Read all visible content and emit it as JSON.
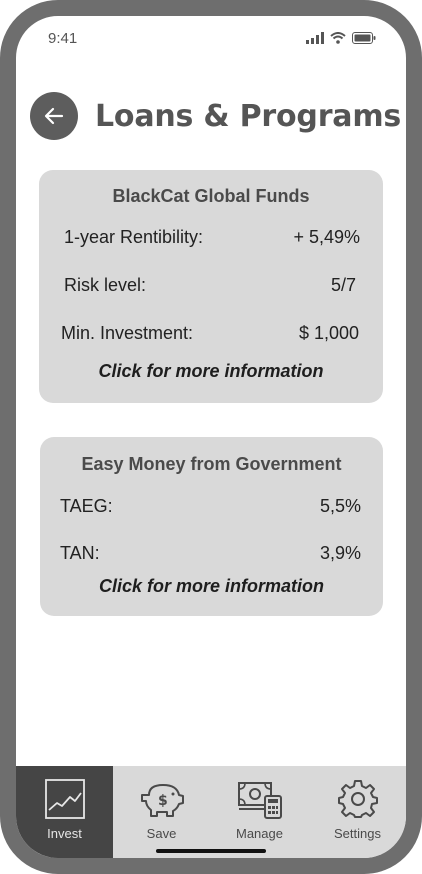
{
  "status": {
    "time": "9:41"
  },
  "header": {
    "title": "Loans & Programs"
  },
  "cards": [
    {
      "title": "BlackCat Global Funds",
      "rows": [
        {
          "label": "1-year Rentibility:",
          "value": "+ 5,49%"
        },
        {
          "label": "Risk level:",
          "value": "5/7"
        },
        {
          "label": "Min. Investment:",
          "value": "$ 1,000"
        }
      ],
      "more": "Click for more information"
    },
    {
      "title": "Easy Money from Government",
      "rows": [
        {
          "label": "TAEG:",
          "value": "5,5%"
        },
        {
          "label": "TAN:",
          "value": "3,9%"
        }
      ],
      "more": "Click for more information"
    }
  ],
  "tabs": [
    {
      "label": "Invest",
      "icon": "chart-icon",
      "active": true
    },
    {
      "label": "Save",
      "icon": "piggy-bank-icon",
      "active": false
    },
    {
      "label": "Manage",
      "icon": "money-calculator-icon",
      "active": false
    },
    {
      "label": "Settings",
      "icon": "gear-icon",
      "active": false
    }
  ]
}
